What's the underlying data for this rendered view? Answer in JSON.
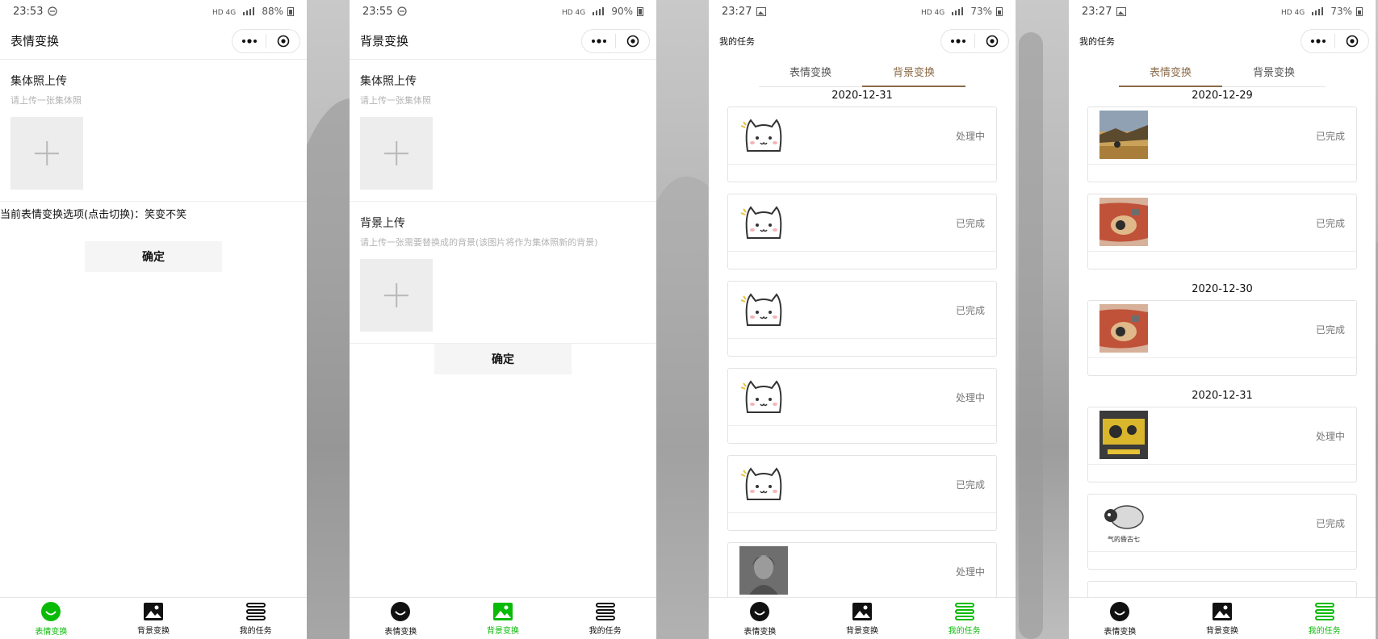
{
  "phones": [
    {
      "status": {
        "time": "23:53",
        "battery": "88%"
      },
      "nav": {
        "title": "表情变换"
      },
      "upload_group": {
        "title": "集体照上传",
        "hint": "请上传一张集体照"
      },
      "option_text": "当前表情变换选项(点击切换)：笑变不笑",
      "confirm_label": "确定"
    },
    {
      "status": {
        "time": "23:55",
        "battery": "90%"
      },
      "nav": {
        "title": "背景变换"
      },
      "upload_group": {
        "title": "集体照上传",
        "hint": "请上传一张集体照"
      },
      "upload_bg": {
        "title": "背景上传",
        "hint": "请上传一张需要替换成的背景(该图片将作为集体照新的背景)"
      },
      "confirm_label": "确定"
    },
    {
      "status": {
        "time": "23:27",
        "battery": "73%"
      },
      "nav": {
        "title": "我的任务"
      },
      "tabs": [
        "表情变换",
        "背景变换"
      ],
      "active_tab": 1,
      "date": "2020-12-31",
      "cards": [
        {
          "status": "处理中",
          "thumb": "cat-sticker"
        },
        {
          "status": "已完成",
          "thumb": "cat-sticker"
        },
        {
          "status": "已完成",
          "thumb": "cat-sticker"
        },
        {
          "status": "处理中",
          "thumb": "cat-sticker"
        },
        {
          "status": "已完成",
          "thumb": "cat-sticker"
        },
        {
          "status": "处理中",
          "thumb": "portrait-photo"
        }
      ]
    },
    {
      "status": {
        "time": "23:27",
        "battery": "73%"
      },
      "nav": {
        "title": "我的任务"
      },
      "tabs": [
        "表情变换",
        "背景变换"
      ],
      "active_tab": 0,
      "groups": [
        {
          "date": "2020-12-29",
          "cards": [
            {
              "status": "已完成",
              "thumb": "landscape-photo"
            },
            {
              "status": "已完成",
              "thumb": "poster-photo"
            }
          ]
        },
        {
          "date": "2020-12-30",
          "cards": [
            {
              "status": "已完成",
              "thumb": "poster-photo"
            }
          ]
        },
        {
          "date": "2020-12-31",
          "cards": [
            {
              "status": "处理中",
              "thumb": "yellow-poster"
            },
            {
              "status": "已完成",
              "thumb": "penguin-sticker",
              "caption": "气的昏古七"
            }
          ]
        }
      ]
    }
  ],
  "tabbar": {
    "items": [
      "表情变换",
      "背景变换",
      "我的任务"
    ],
    "active_per_phone": [
      0,
      1,
      2,
      2
    ]
  },
  "colors": {
    "active_green": "#09bb07",
    "tab_brown": "#8b6a47"
  }
}
